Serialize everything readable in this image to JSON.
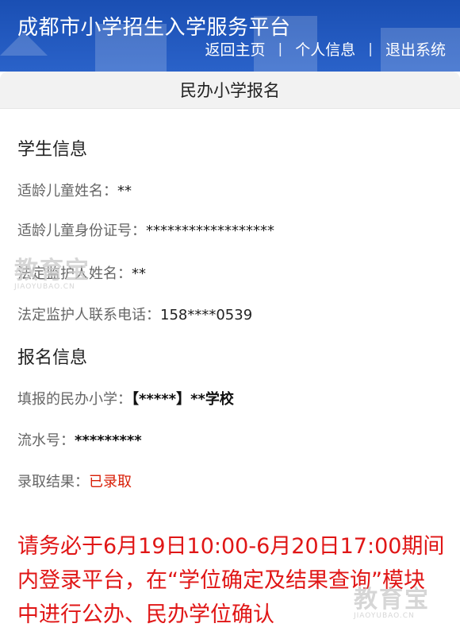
{
  "header": {
    "app_title": "成都市小学招生入学服务平台",
    "nav": {
      "home": "返回主页",
      "profile": "个人信息",
      "logout": "退出系统",
      "separator": "|"
    }
  },
  "page_title": "民办小学报名",
  "student_info": {
    "section_title": "学生信息",
    "name_label": "适龄儿童姓名：",
    "name_value": "**",
    "id_label": "适龄儿童身份证号：",
    "id_value": "******************",
    "guardian_label": "法定监护人姓名：",
    "guardian_value": "**",
    "phone_label": "法定监护人联系电话：",
    "phone_value": "158****0539"
  },
  "enroll_info": {
    "section_title": "报名信息",
    "school_label": "填报的民办小学：",
    "school_value": "【*****】**学校",
    "serial_label": "流水号：",
    "serial_value": "*********",
    "result_label": "录取结果：",
    "result_value": "已录取"
  },
  "notice": "请务必于6月19日10:00-6月20日17:00期间内登录平台，在“学位确定及结果查询”模块中进行公办、民办学位确认",
  "watermark": {
    "text": "教育宝",
    "url": "JIAOYUBAO.CN"
  },
  "colors": {
    "header_bg": "#1f56bd",
    "accent_red": "#e01616",
    "result_red": "#d81e06"
  }
}
